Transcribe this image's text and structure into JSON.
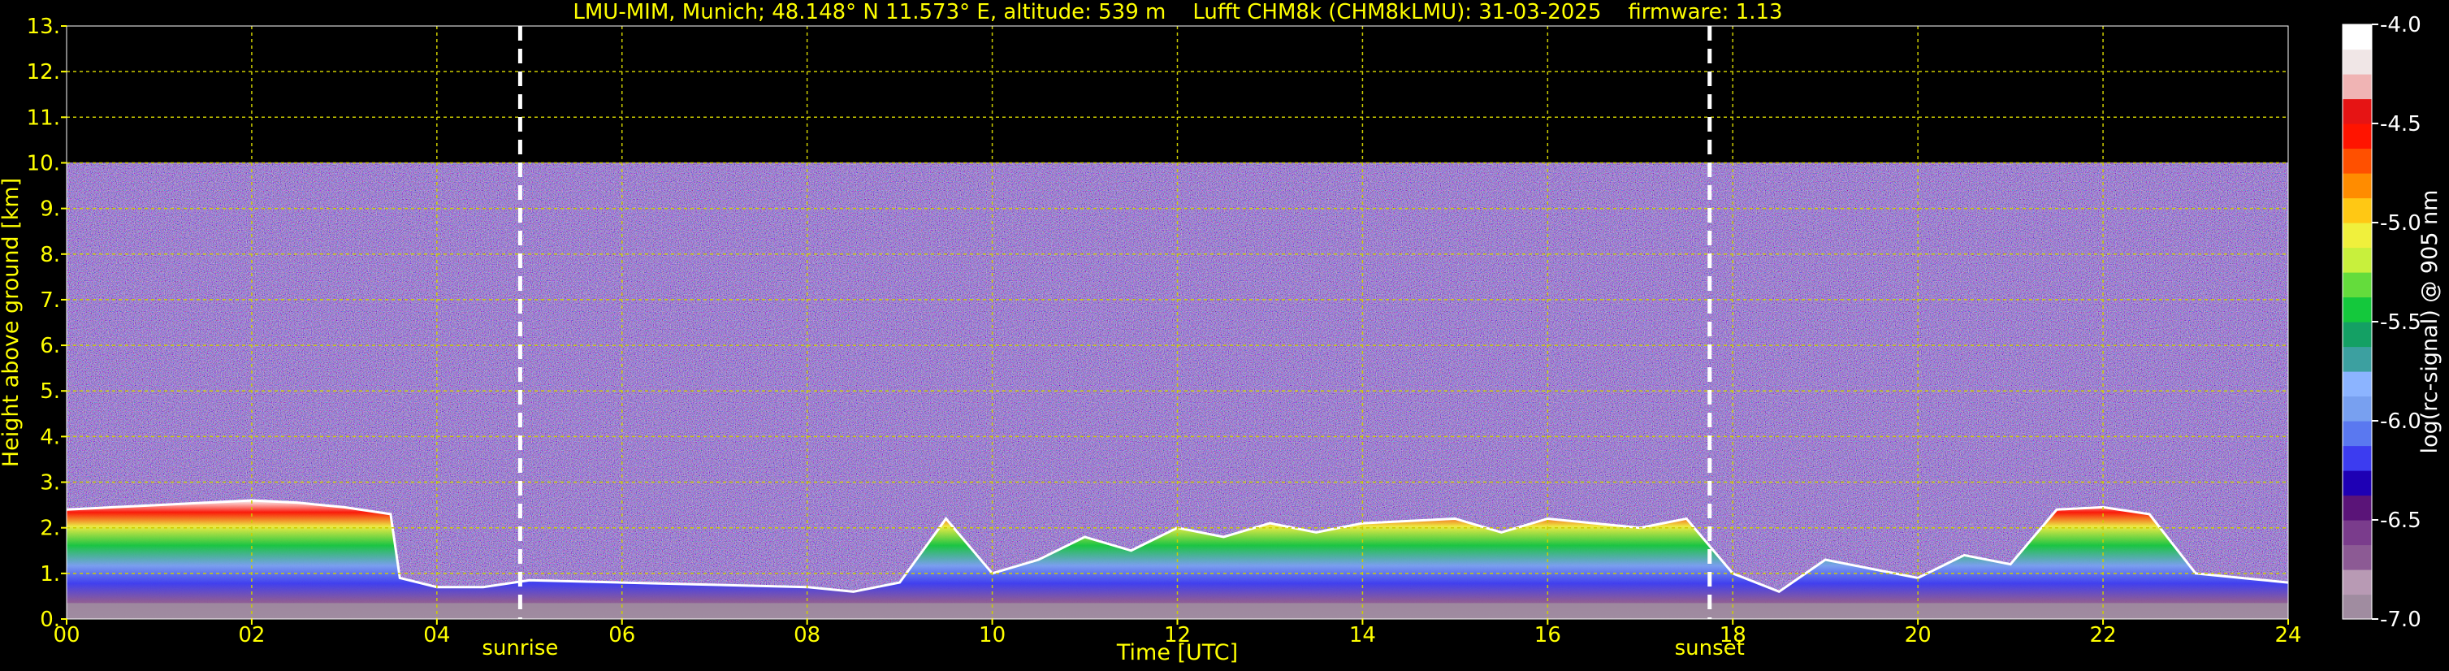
{
  "chart_data": {
    "type": "heatmap",
    "title": "LMU-MIM, Munich; 48.148° N 11.573° E, altitude: 539 m    Lufft CHM8k (CHM8kLMU): 31-03-2025    firmware: 1.13",
    "xlabel": "Time [UTC]",
    "ylabel": "Height above ground [km]",
    "colorbar_label": "log(rc-signal) @ 905 nm",
    "xlim": [
      0,
      24
    ],
    "ylim": [
      0,
      13
    ],
    "clim": [
      -7.0,
      -4.0
    ],
    "x_ticks": [
      "00",
      "02",
      "04",
      "06",
      "08",
      "10",
      "12",
      "14",
      "16",
      "18",
      "20",
      "22",
      "24"
    ],
    "y_ticks": [
      "0.",
      "1.",
      "2.",
      "3.",
      "4.",
      "5.",
      "6.",
      "7.",
      "8.",
      "9.",
      "10.",
      "11.",
      "12.",
      "13."
    ],
    "colorbar_ticks": [
      "-4.0",
      "-4.5",
      "-5.0",
      "-5.5",
      "-6.0",
      "-6.5",
      "-7.0"
    ],
    "grid": true,
    "markers": [
      {
        "label": "sunrise",
        "time_utc": 4.9
      },
      {
        "label": "sunset",
        "time_utc": 17.75
      }
    ],
    "noise_top_km": 10.0,
    "boundary_layer_top_km": [
      [
        0,
        2.4
      ],
      [
        0.5,
        2.45
      ],
      [
        1,
        2.5
      ],
      [
        1.5,
        2.55
      ],
      [
        2,
        2.6
      ],
      [
        2.5,
        2.55
      ],
      [
        3,
        2.45
      ],
      [
        3.5,
        2.3
      ],
      [
        3.6,
        0.9
      ],
      [
        4,
        0.7
      ],
      [
        4.5,
        0.7
      ],
      [
        5,
        0.85
      ],
      [
        6,
        0.8
      ],
      [
        7,
        0.75
      ],
      [
        8,
        0.7
      ],
      [
        8.5,
        0.6
      ],
      [
        9,
        0.8
      ],
      [
        9.5,
        2.2
      ],
      [
        10,
        1.0
      ],
      [
        10.5,
        1.3
      ],
      [
        11,
        1.8
      ],
      [
        11.5,
        1.5
      ],
      [
        12,
        2.0
      ],
      [
        12.5,
        1.8
      ],
      [
        13,
        2.1
      ],
      [
        13.5,
        1.9
      ],
      [
        14,
        2.1
      ],
      [
        15,
        2.2
      ],
      [
        15.5,
        1.9
      ],
      [
        16,
        2.2
      ],
      [
        16.5,
        2.1
      ],
      [
        17,
        2.0
      ],
      [
        17.5,
        2.2
      ],
      [
        18,
        1.0
      ],
      [
        18.5,
        0.6
      ],
      [
        19,
        1.3
      ],
      [
        19.5,
        1.1
      ],
      [
        20,
        0.9
      ],
      [
        20.5,
        1.4
      ],
      [
        21,
        1.2
      ],
      [
        21.5,
        2.4
      ],
      [
        22,
        2.45
      ],
      [
        22.5,
        2.3
      ],
      [
        23,
        1.0
      ],
      [
        23.5,
        0.9
      ],
      [
        24,
        0.8
      ]
    ],
    "colors": {
      "text": "#ffff00",
      "grid": "#cccc00",
      "marker": "#ffffff",
      "background": "#000000",
      "colorbar": [
        "#a08ca0",
        "#b89ab4",
        "#8c5a94",
        "#7a3c8c",
        "#5a1478",
        "#1e00b4",
        "#3c3cf0",
        "#5a78f0",
        "#78a0f0",
        "#8cb4ff",
        "#3ca0a0",
        "#14a064",
        "#14c83c",
        "#64dc3c",
        "#c8f03c",
        "#f0f03c",
        "#ffc814",
        "#ff8c00",
        "#ff5000",
        "#ff1400",
        "#e61414",
        "#f0b4b4",
        "#f0e6e6",
        "#ffffff"
      ]
    }
  }
}
